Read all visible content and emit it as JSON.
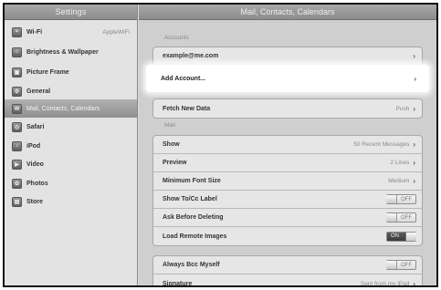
{
  "sidebar": {
    "title": "Settings",
    "items": [
      {
        "label": "Wi-Fi",
        "value": "AppleWiFi",
        "icon": "wifi-icon"
      },
      {
        "label": "Brightness & Wallpaper",
        "value": "",
        "icon": "brightness-icon"
      },
      {
        "label": "Picture Frame",
        "value": "",
        "icon": "picture-frame-icon"
      },
      {
        "label": "General",
        "value": "",
        "icon": "gear-icon"
      },
      {
        "label": "Mail, Contacts, Calendars",
        "value": "",
        "icon": "mail-icon"
      },
      {
        "label": "Safari",
        "value": "",
        "icon": "safari-icon"
      },
      {
        "label": "iPod",
        "value": "",
        "icon": "ipod-icon"
      },
      {
        "label": "Video",
        "value": "",
        "icon": "video-icon"
      },
      {
        "label": "Photos",
        "value": "",
        "icon": "photos-icon"
      },
      {
        "label": "Store",
        "value": "",
        "icon": "store-icon"
      }
    ]
  },
  "main": {
    "title": "Mail, Contacts, Calendars",
    "accounts_label": "Accounts",
    "account_email": "example@me.com",
    "add_account": "Add Account...",
    "fetch_label": "Fetch New Data",
    "fetch_value": "Push",
    "mail_label": "Mail",
    "show_label": "Show",
    "show_value": "50 Recent Messages",
    "preview_label": "Preview",
    "preview_value": "2 Lines",
    "min_font_label": "Minimum Font Size",
    "min_font_value": "Medium",
    "tocc_label": "Show To/Cc Label",
    "tocc_state": "OFF",
    "ask_delete_label": "Ask Before Deleting",
    "ask_delete_state": "OFF",
    "load_images_label": "Load Remote Images",
    "load_images_state": "ON",
    "bcc_label": "Always Bcc Myself",
    "bcc_state": "OFF",
    "signature_label": "Signature",
    "signature_value": "Sent from my iPad"
  }
}
